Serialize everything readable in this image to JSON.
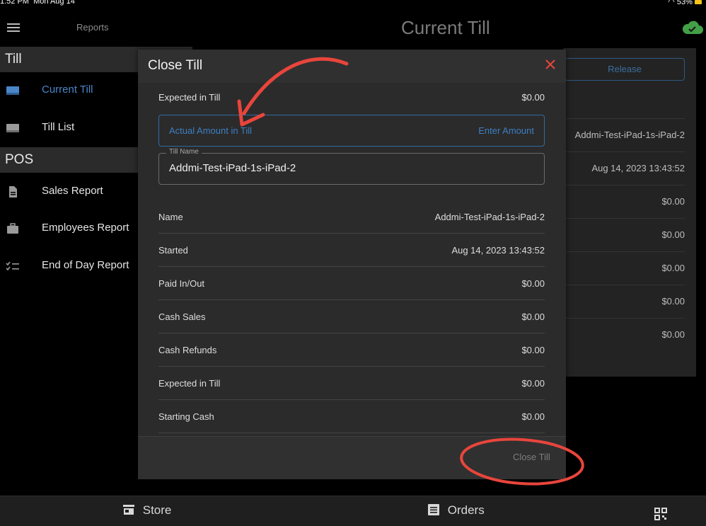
{
  "status_bar": {
    "time": "1:52 PM",
    "date": "Mon Aug 14",
    "battery": "53%"
  },
  "sidebar": {
    "title": "Reports",
    "sections": [
      {
        "label": "Till",
        "items": [
          {
            "label": "Current Till",
            "icon": "till-icon",
            "active": true
          },
          {
            "label": "Till List",
            "icon": "till-icon",
            "active": false
          }
        ]
      },
      {
        "label": "POS",
        "items": [
          {
            "label": "Sales Report",
            "icon": "document-icon"
          },
          {
            "label": "Employees Report",
            "icon": "briefcase-icon"
          },
          {
            "label": "End of Day Report",
            "icon": "checklist-icon"
          }
        ]
      }
    ]
  },
  "header": {
    "title": "Current Till",
    "sync_icon": "cloud-check-icon"
  },
  "background_panel": {
    "release_label": "Release",
    "values": [
      "Addmi-Test-iPad-1s-iPad-2",
      "Aug 14, 2023 13:43:52",
      "$0.00",
      "$0.00",
      "$0.00",
      "$0.00",
      "$0.00"
    ]
  },
  "modal": {
    "title": "Close Till",
    "expected_label": "Expected in Till",
    "expected_value": "$0.00",
    "amount_label": "Actual Amount in Till",
    "amount_placeholder": "Enter Amount",
    "till_name_label": "Till Name",
    "till_name_value": "Addmi-Test-iPad-1s-iPad-2",
    "rows": [
      {
        "label": "Name",
        "value": "Addmi-Test-iPad-1s-iPad-2"
      },
      {
        "label": "Started",
        "value": "Aug 14, 2023 13:43:52"
      },
      {
        "label": "Paid In/Out",
        "value": "$0.00"
      },
      {
        "label": "Cash Sales",
        "value": "$0.00"
      },
      {
        "label": "Cash Refunds",
        "value": "$0.00"
      },
      {
        "label": "Expected in Till",
        "value": "$0.00"
      },
      {
        "label": "Starting Cash",
        "value": "$0.00"
      }
    ],
    "close_button": "Close Till"
  },
  "bottom_bar": {
    "store": "Store",
    "orders": "Orders"
  },
  "colors": {
    "accent": "#3d7fc4",
    "annotation": "#e8453c",
    "sync": "#43a047"
  }
}
